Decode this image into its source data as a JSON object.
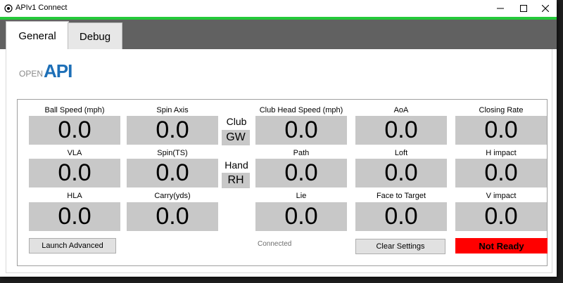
{
  "window": {
    "title": "APIv1 Connect",
    "accent_color": "#25c93a"
  },
  "tabs": [
    {
      "label": "General",
      "active": true
    },
    {
      "label": "Debug",
      "active": false
    }
  ],
  "logo": {
    "open": "OPEN",
    "api": "API"
  },
  "fields": {
    "ball_speed": {
      "label": "Ball Speed (mph)",
      "value": "0.0"
    },
    "spin_axis": {
      "label": "Spin Axis",
      "value": "0.0"
    },
    "club_head_speed": {
      "label": "Club Head Speed (mph)",
      "value": "0.0"
    },
    "aoa": {
      "label": "AoA",
      "value": "0.0"
    },
    "closing_rate": {
      "label": "Closing Rate",
      "value": "0.0"
    },
    "vla": {
      "label": "VLA",
      "value": "0.0"
    },
    "spin_ts": {
      "label": "Spin(TS)",
      "value": "0.0"
    },
    "path": {
      "label": "Path",
      "value": "0.0"
    },
    "loft": {
      "label": "Loft",
      "value": "0.0"
    },
    "h_impact": {
      "label": "H impact",
      "value": "0.0"
    },
    "hla": {
      "label": "HLA",
      "value": "0.0"
    },
    "carry": {
      "label": "Carry(yds)",
      "value": "0.0"
    },
    "lie": {
      "label": "Lie",
      "value": "0.0"
    },
    "face_to_target": {
      "label": "Face to Target",
      "value": "0.0"
    },
    "v_impact": {
      "label": "V impact",
      "value": "0.0"
    }
  },
  "club": {
    "label": "Club",
    "value": "GW"
  },
  "hand": {
    "label": "Hand",
    "value": "RH"
  },
  "buttons": {
    "launch_advanced": "Launch Advanced",
    "clear_settings": "Clear Settings"
  },
  "status": {
    "connection": "Connected",
    "ready": "Not Ready",
    "ready_color": "#ff0000"
  }
}
